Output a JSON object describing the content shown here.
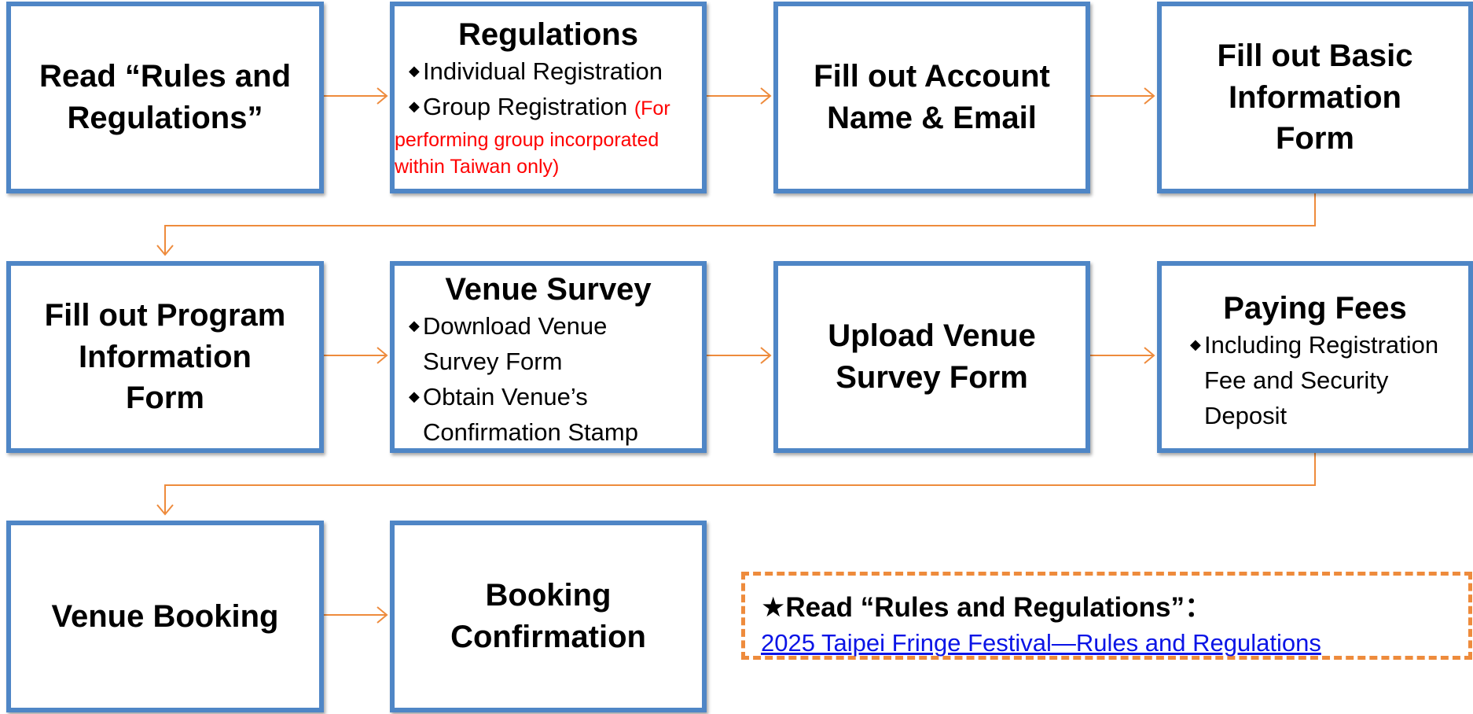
{
  "steps": {
    "read_rules": "Read “Rules and Regulations”",
    "regulations": {
      "title": "Regulations",
      "items": [
        "Individual Registration",
        "Group Registration"
      ],
      "group_note_inline": "(For",
      "group_note": "performing group incorporated within Taiwan only)"
    },
    "account": "Fill out Account Name & Email",
    "basic_info": "Fill out Basic Information Form",
    "program_info": "Fill out Program Information Form",
    "venue_survey": {
      "title": "Venue Survey",
      "items": [
        "Download Venue Survey Form",
        "Obtain Venue’s Confirmation Stamp"
      ]
    },
    "upload_survey": "Upload Venue Survey Form",
    "paying_fees": {
      "title": "Paying Fees",
      "items": [
        "Including Registration Fee and Security Deposit"
      ]
    },
    "venue_booking": "Venue Booking",
    "booking_confirmation": "Booking Confirmation"
  },
  "note": {
    "star": "★",
    "heading": "Read “Rules and Regulations”：",
    "link_text": "2025 Taipei Fringe Festival—Rules and Regulations"
  },
  "bullet_glyph": "◆",
  "colors": {
    "box_border": "#4f86c6",
    "arrow": "#ee8b3c",
    "note_red": "#ff0000",
    "link": "#0b14e6"
  }
}
